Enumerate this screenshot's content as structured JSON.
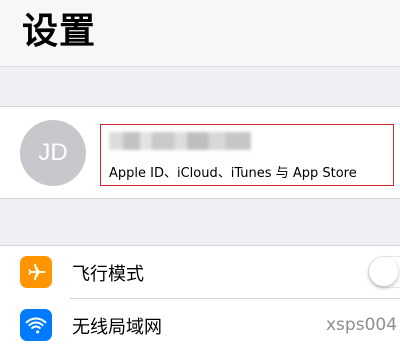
{
  "header": {
    "title": "设置"
  },
  "profile": {
    "avatar_initials": "JD",
    "subtitle": "Apple ID、iCloud、iTunes 与 App Store"
  },
  "settings": {
    "airplane": {
      "label": "飞行模式",
      "icon": "airplane-icon",
      "toggle": "off"
    },
    "wifi": {
      "label": "无线局域网",
      "icon": "wifi-icon",
      "value": "xsps004"
    }
  },
  "colors": {
    "airplane_icon_bg": "#ff9500",
    "wifi_icon_bg": "#007aff",
    "highlight_border": "#d1272b"
  }
}
